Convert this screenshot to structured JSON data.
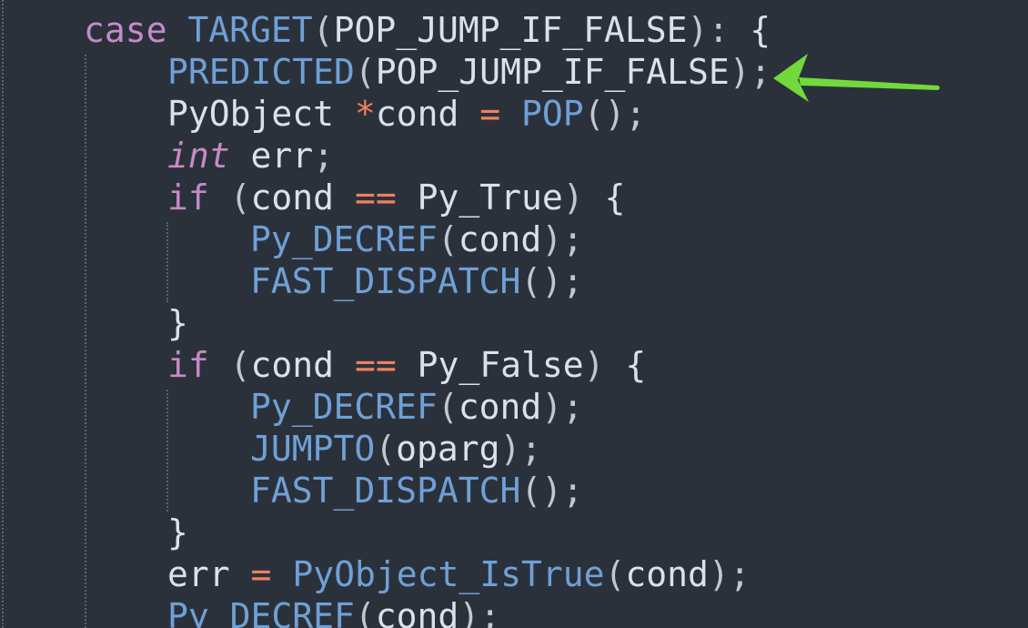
{
  "editor": {
    "theme": {
      "background": "#2b313b",
      "keyword": "#c68ac6",
      "function": "#6fa0d6",
      "operator": "#f0815e",
      "text": "#dbe1ea",
      "annotation_arrow": "#72d93a"
    },
    "lines": [
      {
        "indent": 1,
        "tokens": [
          {
            "t": "case",
            "c": "kw"
          },
          {
            "t": " ",
            "c": "tx"
          },
          {
            "t": "TARGET",
            "c": "fn"
          },
          {
            "t": "(",
            "c": "pn"
          },
          {
            "t": "POP_JUMP_IF_FALSE",
            "c": "tx"
          },
          {
            "t": ")",
            "c": "pn"
          },
          {
            "t": ":",
            "c": "pn"
          },
          {
            "t": " ",
            "c": "tx"
          },
          {
            "t": "{",
            "c": "tx"
          }
        ]
      },
      {
        "indent": 2,
        "tokens": [
          {
            "t": "PREDICTED",
            "c": "fn"
          },
          {
            "t": "(",
            "c": "pn"
          },
          {
            "t": "POP_JUMP_IF_FALSE",
            "c": "tx"
          },
          {
            "t": ")",
            "c": "pn"
          },
          {
            "t": ";",
            "c": "pn"
          }
        ]
      },
      {
        "indent": 2,
        "tokens": [
          {
            "t": "PyObject",
            "c": "tx"
          },
          {
            "t": " ",
            "c": "tx"
          },
          {
            "t": "*",
            "c": "op"
          },
          {
            "t": "cond",
            "c": "tx"
          },
          {
            "t": " ",
            "c": "tx"
          },
          {
            "t": "=",
            "c": "op"
          },
          {
            "t": " ",
            "c": "tx"
          },
          {
            "t": "POP",
            "c": "fn"
          },
          {
            "t": "()",
            "c": "pn"
          },
          {
            "t": ";",
            "c": "pn"
          }
        ]
      },
      {
        "indent": 2,
        "tokens": [
          {
            "t": "int",
            "c": "kw-i"
          },
          {
            "t": " err",
            "c": "tx"
          },
          {
            "t": ";",
            "c": "pn"
          }
        ]
      },
      {
        "indent": 2,
        "tokens": [
          {
            "t": "if",
            "c": "kw"
          },
          {
            "t": " ",
            "c": "tx"
          },
          {
            "t": "(",
            "c": "pn"
          },
          {
            "t": "cond",
            "c": "tx"
          },
          {
            "t": " ",
            "c": "tx"
          },
          {
            "t": "==",
            "c": "op"
          },
          {
            "t": " ",
            "c": "tx"
          },
          {
            "t": "Py_True",
            "c": "tx"
          },
          {
            "t": ")",
            "c": "pn"
          },
          {
            "t": " ",
            "c": "tx"
          },
          {
            "t": "{",
            "c": "tx"
          }
        ]
      },
      {
        "indent": 3,
        "tokens": [
          {
            "t": "Py_DECREF",
            "c": "fn"
          },
          {
            "t": "(",
            "c": "pn"
          },
          {
            "t": "cond",
            "c": "tx"
          },
          {
            "t": ")",
            "c": "pn"
          },
          {
            "t": ";",
            "c": "pn"
          }
        ]
      },
      {
        "indent": 3,
        "tokens": [
          {
            "t": "FAST_DISPATCH",
            "c": "fn"
          },
          {
            "t": "()",
            "c": "pn"
          },
          {
            "t": ";",
            "c": "pn"
          }
        ]
      },
      {
        "indent": 2,
        "tokens": [
          {
            "t": "}",
            "c": "tx"
          }
        ]
      },
      {
        "indent": 2,
        "tokens": [
          {
            "t": "if",
            "c": "kw"
          },
          {
            "t": " ",
            "c": "tx"
          },
          {
            "t": "(",
            "c": "pn"
          },
          {
            "t": "cond",
            "c": "tx"
          },
          {
            "t": " ",
            "c": "tx"
          },
          {
            "t": "==",
            "c": "op"
          },
          {
            "t": " ",
            "c": "tx"
          },
          {
            "t": "Py_False",
            "c": "tx"
          },
          {
            "t": ")",
            "c": "pn"
          },
          {
            "t": " ",
            "c": "tx"
          },
          {
            "t": "{",
            "c": "tx"
          }
        ]
      },
      {
        "indent": 3,
        "tokens": [
          {
            "t": "Py_DECREF",
            "c": "fn"
          },
          {
            "t": "(",
            "c": "pn"
          },
          {
            "t": "cond",
            "c": "tx"
          },
          {
            "t": ")",
            "c": "pn"
          },
          {
            "t": ";",
            "c": "pn"
          }
        ]
      },
      {
        "indent": 3,
        "tokens": [
          {
            "t": "JUMPTO",
            "c": "fn"
          },
          {
            "t": "(",
            "c": "pn"
          },
          {
            "t": "oparg",
            "c": "tx"
          },
          {
            "t": ")",
            "c": "pn"
          },
          {
            "t": ";",
            "c": "pn"
          }
        ]
      },
      {
        "indent": 3,
        "tokens": [
          {
            "t": "FAST_DISPATCH",
            "c": "fn"
          },
          {
            "t": "()",
            "c": "pn"
          },
          {
            "t": ";",
            "c": "pn"
          }
        ]
      },
      {
        "indent": 2,
        "tokens": [
          {
            "t": "}",
            "c": "tx"
          }
        ]
      },
      {
        "indent": 2,
        "tokens": [
          {
            "t": "err",
            "c": "tx"
          },
          {
            "t": " ",
            "c": "tx"
          },
          {
            "t": "=",
            "c": "op"
          },
          {
            "t": " ",
            "c": "tx"
          },
          {
            "t": "PyObject_IsTrue",
            "c": "fn"
          },
          {
            "t": "(",
            "c": "pn"
          },
          {
            "t": "cond",
            "c": "tx"
          },
          {
            "t": ")",
            "c": "pn"
          },
          {
            "t": ";",
            "c": "pn"
          }
        ]
      },
      {
        "indent": 2,
        "tokens": [
          {
            "t": "Py_DECREF",
            "c": "fn"
          },
          {
            "t": "(",
            "c": "pn"
          },
          {
            "t": "cond",
            "c": "tx"
          },
          {
            "t": ")",
            "c": "pn"
          },
          {
            "t": ";",
            "c": "pn"
          }
        ]
      }
    ]
  },
  "annotation": {
    "icon": "arrow-left-icon",
    "color": "#72d93a"
  }
}
